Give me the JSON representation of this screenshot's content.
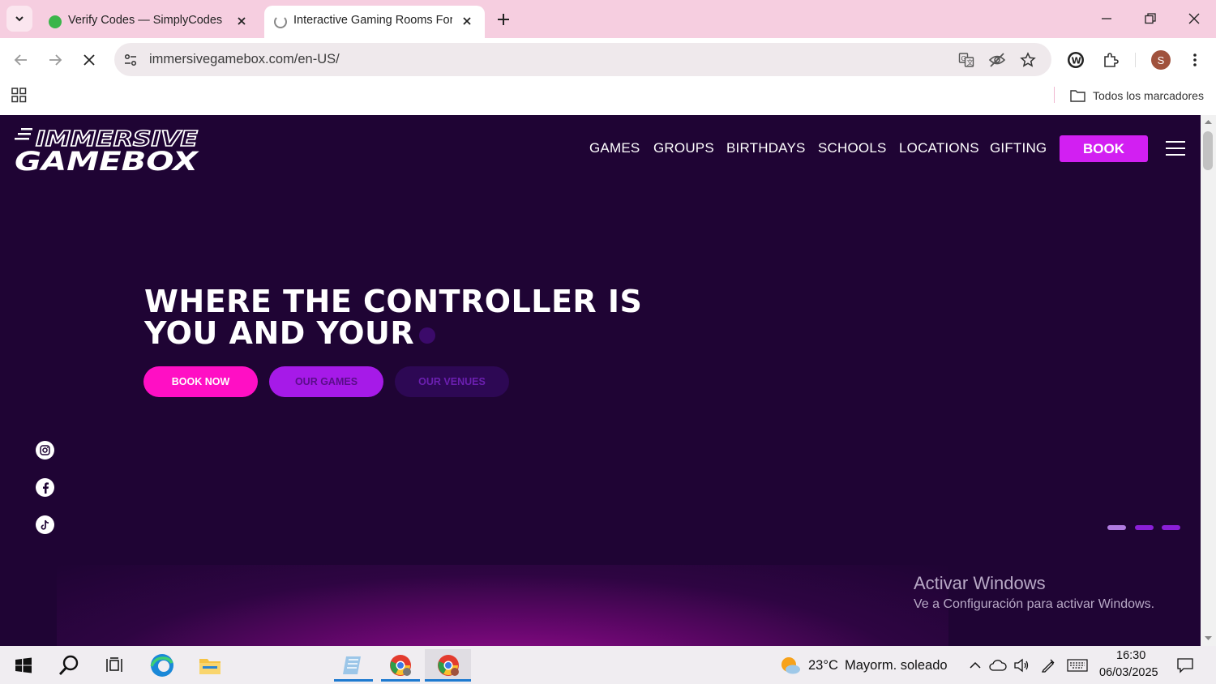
{
  "browser": {
    "tabs": [
      {
        "title": "Verify Codes — SimplyCodes",
        "favicon": "simplycodes-icon",
        "active": false
      },
      {
        "title": "Interactive Gaming Rooms For /",
        "favicon": "loading-spinner-icon",
        "active": true
      }
    ],
    "url": "immersivegamebox.com/en-US/",
    "bookmarks_folder": "Todos los marcadores",
    "profile_initial": "S"
  },
  "site": {
    "logo_line1": "IMMERSIVE",
    "logo_line2": "GAMEBOX",
    "nav": [
      "GAMES",
      "GROUPS",
      "BIRTHDAYS",
      "SCHOOLS",
      "LOCATIONS",
      "GIFTING"
    ],
    "book_label": "BOOK",
    "hero_line1": "WHERE THE CONTROLLER IS",
    "hero_line2": "YOU AND YOUR",
    "cta": [
      {
        "label": "BOOK NOW",
        "bg": "#ff0fc4",
        "color": "#ffffff"
      },
      {
        "label": "OUR GAMES",
        "bg": "#a61ae8",
        "color": "#5a0d8a"
      },
      {
        "label": "OUR VENUES",
        "bg": "#2d0854",
        "color": "#6b1fb0"
      }
    ],
    "social": [
      "instagram-icon",
      "facebook-icon",
      "tiktok-icon"
    ],
    "pagination": {
      "count": 3,
      "active": 1
    }
  },
  "watermark": {
    "title": "Activar Windows",
    "subtitle": "Ve a Configuración para activar Windows."
  },
  "taskbar": {
    "weather_temp": "23°C",
    "weather_desc": "Mayorm. soleado",
    "time": "16:30",
    "date": "06/03/2025"
  },
  "colors": {
    "site_bg": "#1f0434",
    "accent_magenta": "#d21ff2",
    "tabstrip": "#f6cee0"
  }
}
